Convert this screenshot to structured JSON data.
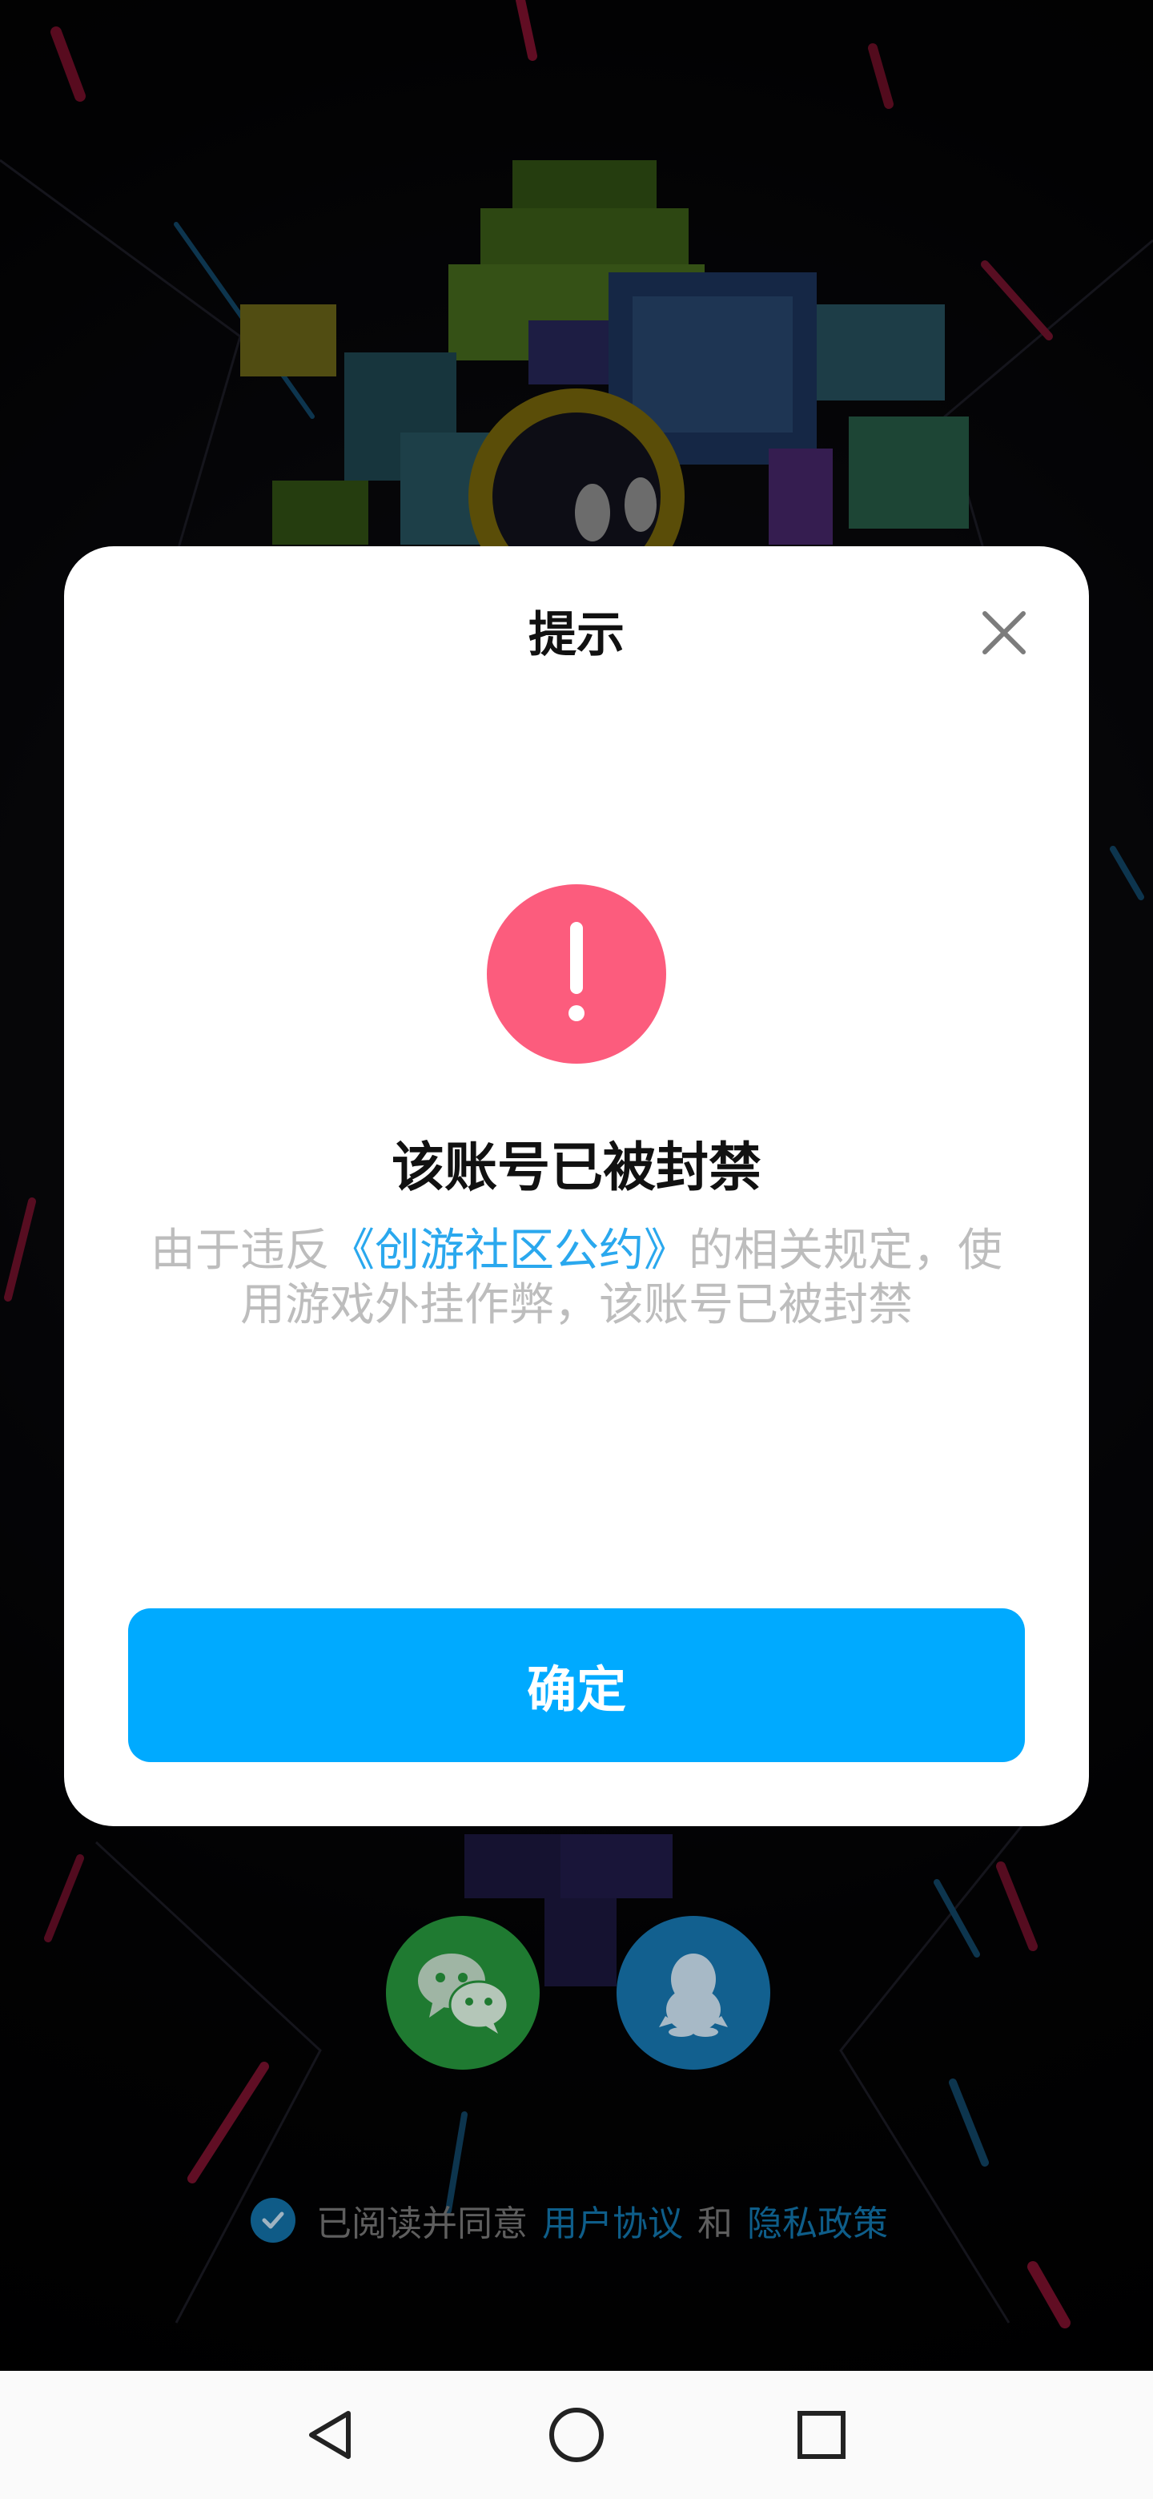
{
  "dialog": {
    "title": "提示",
    "heading": "该账号已被封禁",
    "message_before": "由于违反",
    "message_link": "《创游社区公约》",
    "message_after": "的相关规定，使用游戏外挂作弊，该账号已被封禁",
    "confirm_label": "确定"
  },
  "agreement": {
    "prefix": "已阅读并同意",
    "user_agreement": "用户协议",
    "and": "和",
    "privacy_policy": "隐私政策"
  },
  "colors": {
    "accent": "#00aaff",
    "alert": "#fc5c7d",
    "link": "#2aa8ee",
    "wechat": "#28b43d",
    "qq": "#1282c4"
  },
  "icons": {
    "close": "close-icon",
    "alert": "exclamation-icon",
    "wechat": "wechat-icon",
    "qq": "qq-penguin-icon",
    "check": "check-icon",
    "nav_back": "back-triangle-icon",
    "nav_home": "home-circle-icon",
    "nav_recent": "recent-square-icon"
  }
}
